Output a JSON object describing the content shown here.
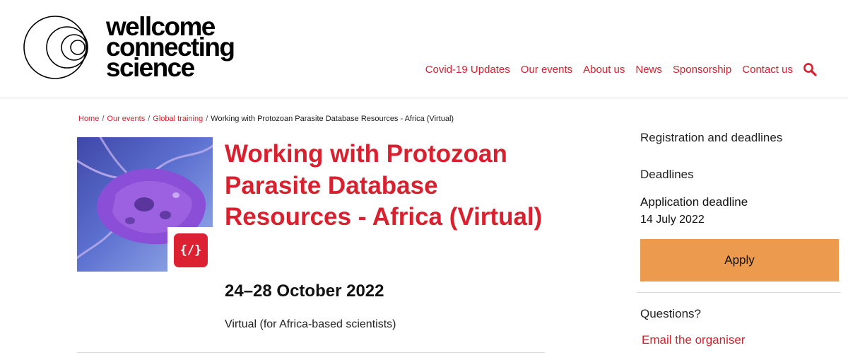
{
  "header": {
    "logo_lines": [
      "wellcome",
      "connecting",
      "science"
    ],
    "nav": [
      "Covid-19 Updates",
      "Our events",
      "About us",
      "News",
      "Sponsorship",
      "Contact us"
    ]
  },
  "breadcrumb": {
    "items": [
      "Home",
      "Our events",
      "Global training"
    ],
    "current": "Working with Protozoan Parasite Database Resources - Africa (Virtual)",
    "separator": "/"
  },
  "event": {
    "title": "Working with Protozoan Parasite Database Resources - Africa (Virtual)",
    "dates": "24–28 October 2022",
    "location": "Virtual (for Africa-based scientists)",
    "badge_icon": "code-icon",
    "badge_glyph": "{/}"
  },
  "sidebar": {
    "registration_heading": "Registration and deadlines",
    "deadlines_label": "Deadlines",
    "application_deadline_label": "Application deadline",
    "application_deadline_date": "14 July 2022",
    "apply_label": "Apply",
    "questions_label": "Questions?",
    "email_label": "Email the organiser"
  },
  "colors": {
    "accent_red": "#d8202f",
    "apply_orange": "#ec9b4e",
    "divider": "#dddddd"
  }
}
